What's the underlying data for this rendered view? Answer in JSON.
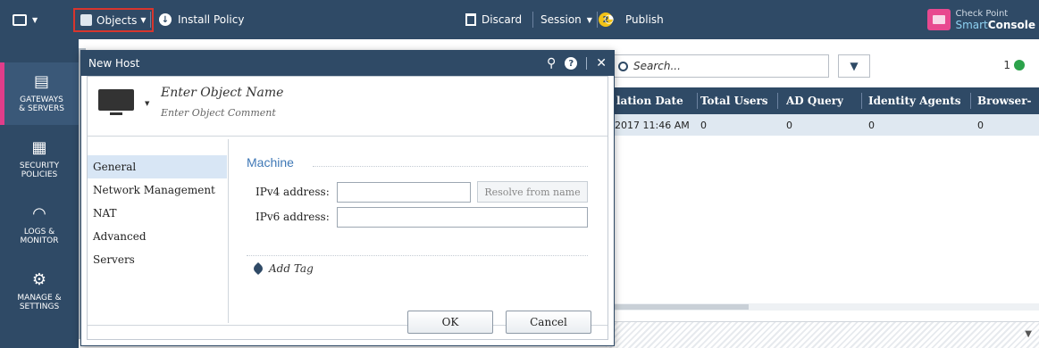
{
  "toolbar": {
    "objects_label": "Objects",
    "install_policy_label": "Install Policy",
    "discard_label": "Discard",
    "session_label": "Session",
    "session_count": "2",
    "publish_label": "Publish",
    "brand_top": "Check Point",
    "brand_bottom_1": "Smart",
    "brand_bottom_2": "Console"
  },
  "leftnav": {
    "items": [
      {
        "line1": "GATEWAYS",
        "line2": "& SERVERS",
        "icon": "gateways-icon"
      },
      {
        "line1": "SECURITY",
        "line2": "POLICIES",
        "icon": "policies-icon"
      },
      {
        "line1": "LOGS &",
        "line2": "MONITOR",
        "icon": "monitor-icon"
      },
      {
        "line1": "MANAGE &",
        "line2": "SETTINGS",
        "icon": "settings-icon"
      }
    ]
  },
  "content": {
    "search_placeholder": "Search...",
    "count": "1",
    "columns": [
      "lation Date",
      "Total Users",
      "AD Query",
      "Identity Agents",
      "Browser-"
    ],
    "row": [
      "2017 11:46 AM",
      "0",
      "0",
      "0",
      "0"
    ]
  },
  "dialog": {
    "title": "New Host",
    "object_name": "Enter Object Name",
    "object_comment": "Enter Object Comment",
    "nav": [
      "General",
      "Network Management",
      "NAT",
      "Advanced",
      "Servers"
    ],
    "section_title": "Machine",
    "ipv4_label": "IPv4 address:",
    "ipv6_label": "IPv6 address:",
    "ipv4_value": "",
    "ipv6_value": "",
    "resolve_label": "Resolve from name",
    "add_tag_label": "Add Tag",
    "ok_label": "OK",
    "cancel_label": "Cancel"
  },
  "colors": {
    "toolbar_bg": "#2f4a66",
    "accent_pink": "#e03d8a",
    "highlight_red": "#d8352d",
    "section_blue": "#3f78b6",
    "badge_yellow": "#f2c318",
    "status_green": "#2ca24b"
  }
}
